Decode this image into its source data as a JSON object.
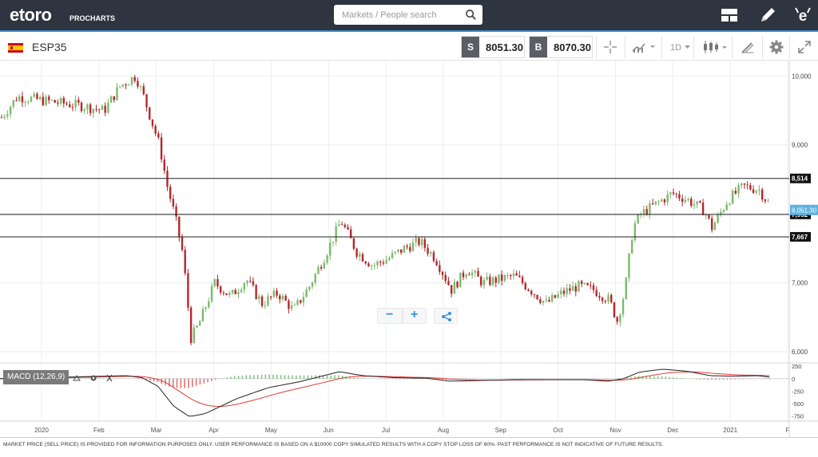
{
  "header": {
    "logo_text": "etoro",
    "logo_sub": "PROCHARTS",
    "search_placeholder": "Markets / People search",
    "icons": [
      "layout-icon",
      "pencil-icon",
      "etoro-e-icon",
      "search-icon"
    ]
  },
  "toolbar": {
    "symbol": "ESP35",
    "sell_tag": "S",
    "sell_price": "8051.30",
    "buy_tag": "B",
    "buy_price": "8070.30",
    "timeframe": "1D",
    "icons": [
      "crosshair-icon",
      "chart-type-icon",
      "candles-icon",
      "draw-icon",
      "gear-icon",
      "fullscreen-icon"
    ]
  },
  "chart_data": {
    "type": "candlestick",
    "instrument": "ESP35",
    "x_tick_labels": [
      "2020",
      "Feb",
      "Mar",
      "Apr",
      "May",
      "Jun",
      "Jul",
      "Aug",
      "Sep",
      "Oct",
      "Nov",
      "Dec",
      "2021",
      "F"
    ],
    "y_tick_labels": [
      "10,000",
      "9,000",
      "8,000",
      "7,000",
      "6,000"
    ],
    "ylim": [
      5850,
      10200
    ],
    "grid": true,
    "horizontal_lines": [
      {
        "value": 8514,
        "label": "8,514"
      },
      {
        "value": 7992,
        "label": "7,992"
      },
      {
        "value": 7667,
        "label": "7,667"
      }
    ],
    "current_price": {
      "value": 8051.3,
      "label": "8,051.30"
    },
    "colors": {
      "up": "#7cb96b",
      "down": "#b4272b",
      "price_tag": "#5eb3e0",
      "macd_line": "#222222",
      "signal_line": "#e53935"
    },
    "close_path": [
      [
        0,
        9400
      ],
      [
        0.02,
        9700
      ],
      [
        0.05,
        9650
      ],
      [
        0.08,
        9600
      ],
      [
        0.1,
        9570
      ],
      [
        0.13,
        9500
      ],
      [
        0.15,
        9850
      ],
      [
        0.17,
        10000
      ],
      [
        0.18,
        9700
      ],
      [
        0.2,
        9000
      ],
      [
        0.21,
        8400
      ],
      [
        0.22,
        7950
      ],
      [
        0.23,
        7400
      ],
      [
        0.24,
        6200
      ],
      [
        0.25,
        6400
      ],
      [
        0.27,
        7000
      ],
      [
        0.29,
        6800
      ],
      [
        0.31,
        7050
      ],
      [
        0.33,
        6700
      ],
      [
        0.35,
        6850
      ],
      [
        0.37,
        6600
      ],
      [
        0.39,
        6950
      ],
      [
        0.41,
        7400
      ],
      [
        0.43,
        7900
      ],
      [
        0.45,
        7450
      ],
      [
        0.47,
        7250
      ],
      [
        0.49,
        7350
      ],
      [
        0.51,
        7500
      ],
      [
        0.53,
        7600
      ],
      [
        0.55,
        7350
      ],
      [
        0.57,
        6900
      ],
      [
        0.59,
        7200
      ],
      [
        0.61,
        7000
      ],
      [
        0.63,
        7050
      ],
      [
        0.65,
        7100
      ],
      [
        0.67,
        6900
      ],
      [
        0.69,
        6700
      ],
      [
        0.71,
        6850
      ],
      [
        0.73,
        6950
      ],
      [
        0.75,
        6900
      ],
      [
        0.77,
        6750
      ],
      [
        0.78,
        6450
      ],
      [
        0.79,
        6900
      ],
      [
        0.8,
        7800
      ],
      [
        0.81,
        8000
      ],
      [
        0.83,
        8150
      ],
      [
        0.85,
        8300
      ],
      [
        0.87,
        8200
      ],
      [
        0.89,
        8050
      ],
      [
        0.9,
        7800
      ],
      [
        0.92,
        8200
      ],
      [
        0.94,
        8400
      ],
      [
        0.96,
        8350
      ],
      [
        0.975,
        8100
      ]
    ],
    "macd": {
      "label": "MACD (12,26,9)",
      "y_tick_labels": [
        "250",
        "0",
        "-250",
        "-500",
        "-750"
      ],
      "ylim": [
        -850,
        300
      ]
    }
  },
  "zoom": {
    "minus": "−",
    "plus": "+"
  },
  "footer": {
    "disclaimer": "MARKET PRICE (SELL PRICE) IS PROVIDED FOR INFORMATION PURPOSES ONLY. USER PERFORMANCE IS BASED ON A $10000 COPY SIMULATED RESULTS WITH A COPY STOP LOSS OF 60%. PAST PERFORMANCE IS NOT INDICATIVE OF FUTURE RESULTS."
  }
}
